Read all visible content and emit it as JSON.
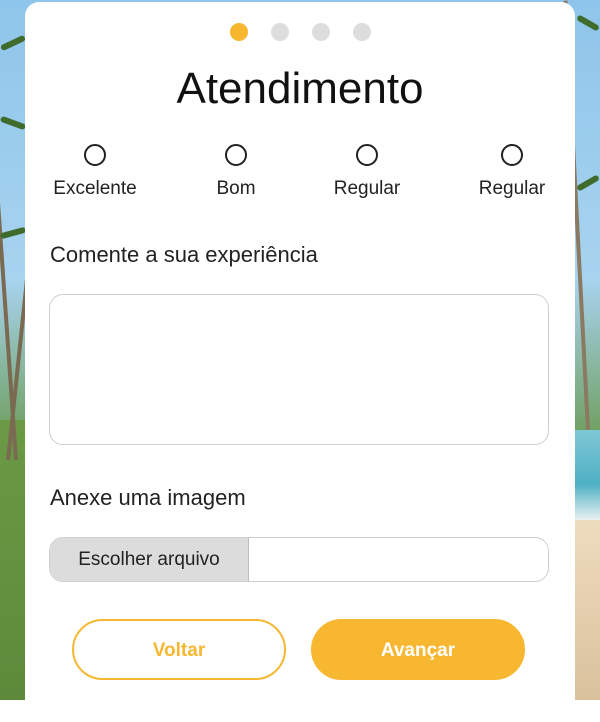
{
  "progress": {
    "steps": 4,
    "active_index": 0,
    "active_color": "#f7b731",
    "inactive_color": "#dddddd"
  },
  "form": {
    "title": "Atendimento",
    "ratings": [
      {
        "label": "Excelente"
      },
      {
        "label": "Bom"
      },
      {
        "label": "Regular"
      },
      {
        "label": "Regular"
      }
    ],
    "comment_label": "Comente a sua experiência",
    "comment_value": "",
    "attach_label": "Anexe uma imagem",
    "file_button_label": "Escolher arquivo",
    "file_name": ""
  },
  "actions": {
    "back_label": "Voltar",
    "next_label": "Avançar"
  },
  "colors": {
    "accent": "#f7b731",
    "card_background": "#ffffff"
  }
}
